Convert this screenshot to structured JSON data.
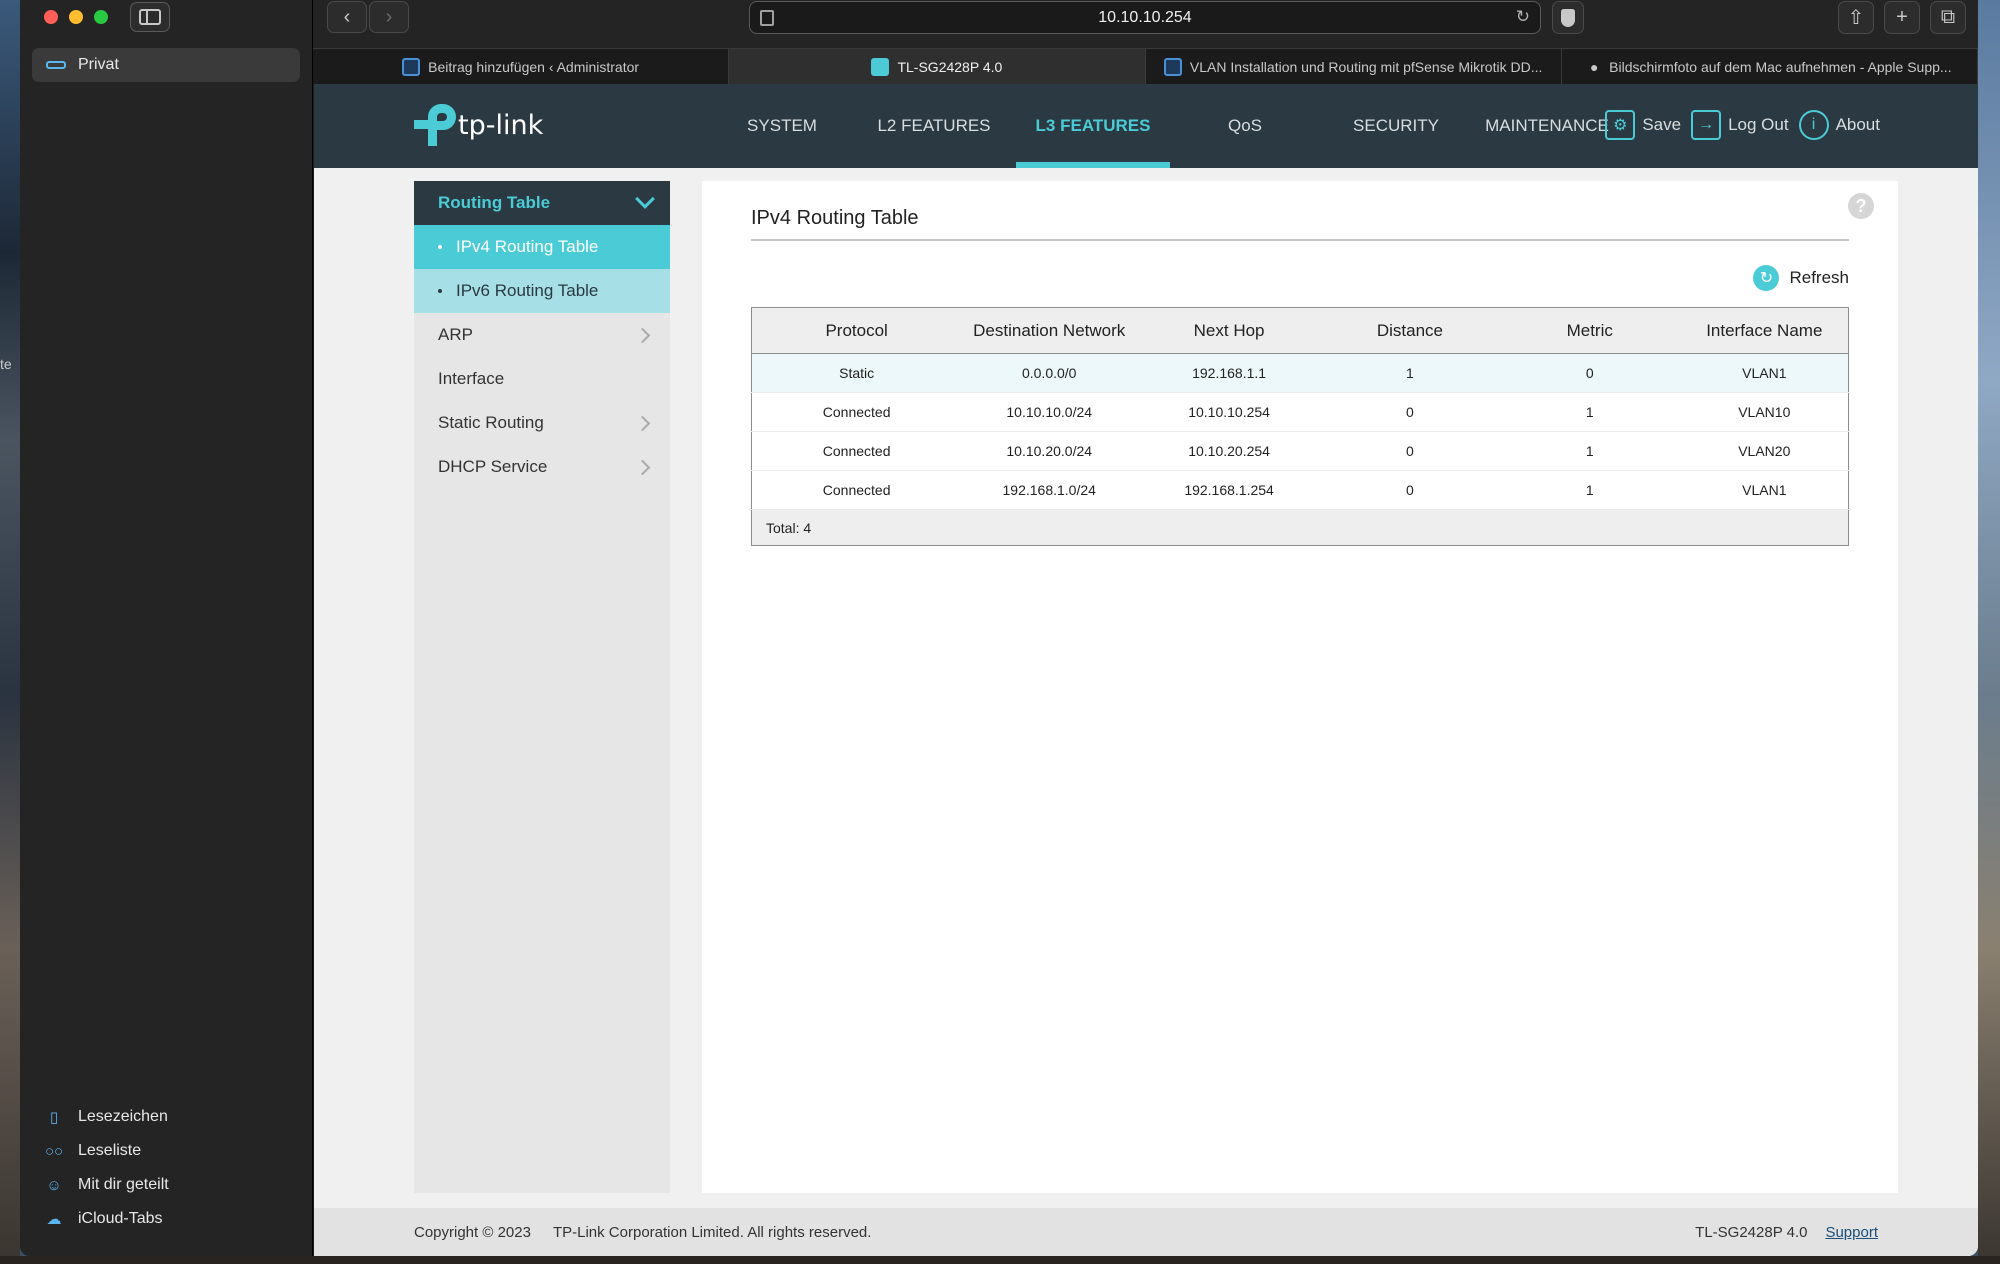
{
  "desktop": {
    "left_edge_text": "te"
  },
  "browser": {
    "profile": "Privat",
    "url": "10.10.10.254",
    "sidebar_bottom": [
      {
        "icon": "bookmark-icon",
        "label": "Lesezeichen"
      },
      {
        "icon": "reading-list-icon",
        "label": "Leseliste"
      },
      {
        "icon": "shared-with-you-icon",
        "label": "Mit dir geteilt"
      },
      {
        "icon": "icloud-icon",
        "label": "iCloud-Tabs"
      }
    ],
    "tabs": [
      {
        "title": "Beitrag hinzufügen ‹ Administrator",
        "active": false,
        "icon": "wordpress-icon"
      },
      {
        "title": "TL-SG2428P 4.0",
        "active": true,
        "icon": "tplink-icon"
      },
      {
        "title": "VLAN Installation und Routing mit pfSense Mikrotik DD...",
        "active": false,
        "icon": "wordpress-icon"
      },
      {
        "title": "Bildschirmfoto auf dem Mac aufnehmen - Apple Supp...",
        "active": false,
        "icon": "apple-icon"
      }
    ]
  },
  "router": {
    "brand": "tp-link",
    "nav": [
      "SYSTEM",
      "L2 FEATURES",
      "L3 FEATURES",
      "QoS",
      "SECURITY",
      "MAINTENANCE"
    ],
    "nav_active": "L3 FEATURES",
    "actions": {
      "save": "Save",
      "logout": "Log Out",
      "about": "About"
    },
    "menu": {
      "section": "Routing Table",
      "sub_items": [
        "IPv4 Routing Table",
        "IPv6 Routing Table"
      ],
      "items": [
        "ARP",
        "Interface",
        "Static Routing",
        "DHCP Service"
      ]
    },
    "content": {
      "title": "IPv4 Routing Table",
      "refresh": "Refresh",
      "help": "?",
      "columns": [
        "Protocol",
        "Destination Network",
        "Next Hop",
        "Distance",
        "Metric",
        "Interface Name"
      ],
      "rows": [
        [
          "Static",
          "0.0.0.0/0",
          "192.168.1.1",
          "1",
          "0",
          "VLAN1"
        ],
        [
          "Connected",
          "10.10.10.0/24",
          "10.10.10.254",
          "0",
          "1",
          "VLAN10"
        ],
        [
          "Connected",
          "10.10.20.0/24",
          "10.10.20.254",
          "0",
          "1",
          "VLAN20"
        ],
        [
          "Connected",
          "192.168.1.0/24",
          "192.168.1.254",
          "0",
          "1",
          "VLAN1"
        ]
      ],
      "total": "Total: 4"
    },
    "footer": {
      "copyright": "Copyright © 2023",
      "company": "TP-Link Corporation Limited. All rights reserved.",
      "model": "TL-SG2428P 4.0",
      "support": "Support"
    }
  }
}
